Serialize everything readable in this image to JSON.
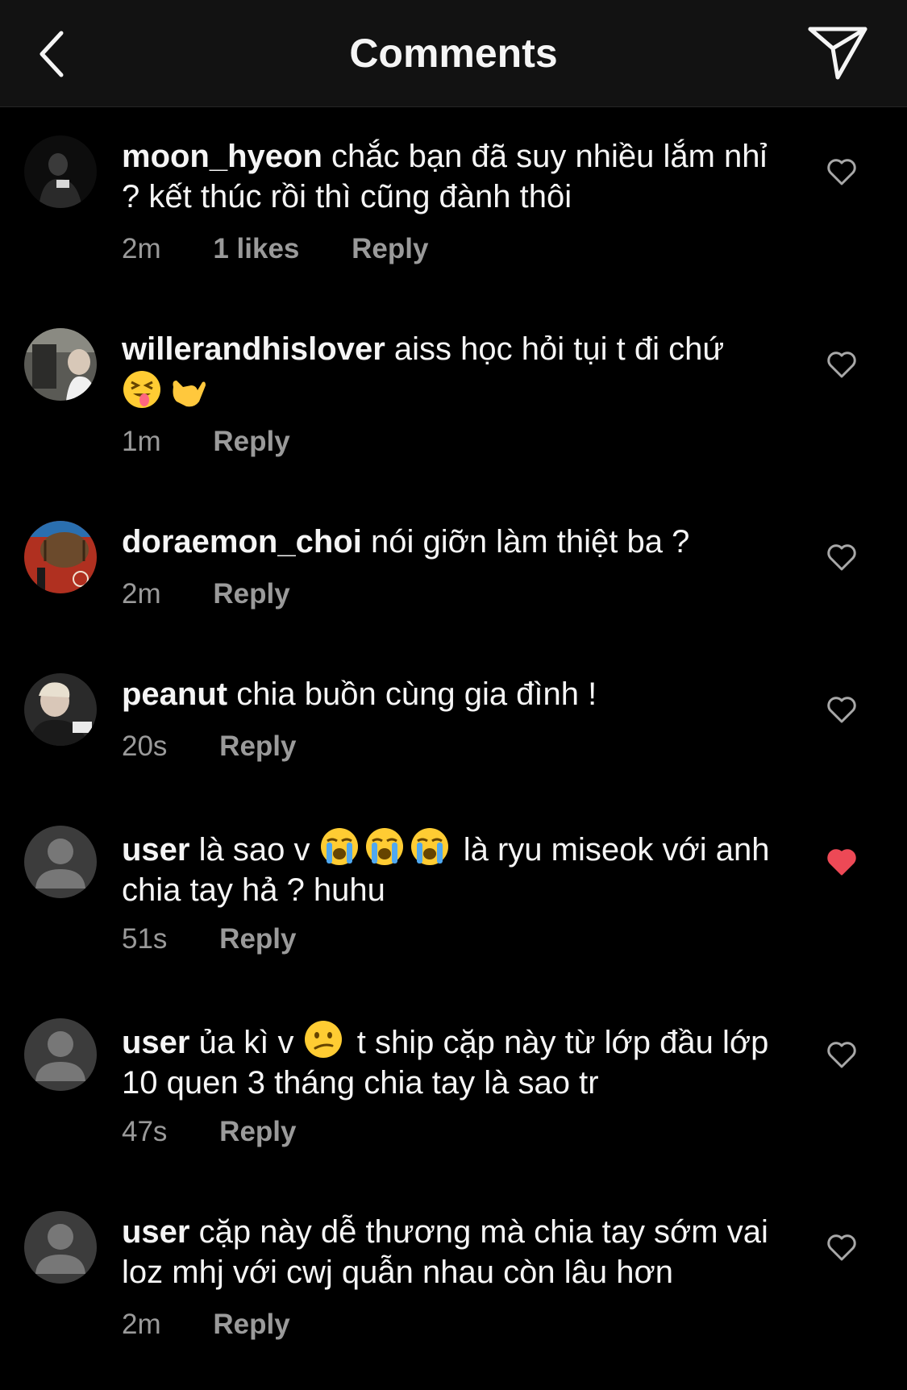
{
  "header": {
    "title": "Comments",
    "back_icon": "chevron-left-icon",
    "send_icon": "paper-plane-icon"
  },
  "colors": {
    "background": "#000000",
    "header_background": "#121212",
    "meta_text": "#9a9a9a",
    "liked_heart": "#ed4956"
  },
  "comments": [
    {
      "username": "moon_hyeon",
      "text": "chắc bạn đã suy nhiều lắm nhỉ ? kết thúc rồi thì cũng đành thôi",
      "time": "2m",
      "likes": "1 likes",
      "reply": "Reply",
      "liked": false
    },
    {
      "username": "willerandhislover",
      "text": "aiss học hỏi tụi t đi chứ",
      "emojis": [
        "squinting-tongue-emoji",
        "call-me-hand-emoji"
      ],
      "time": "1m",
      "reply": "Reply",
      "liked": false
    },
    {
      "username": "doraemon_choi",
      "text": " nói giỡn làm thiệt ba ?",
      "time": "2m",
      "reply": "Reply",
      "liked": false
    },
    {
      "username": "peanut",
      "text": "chia buồn cùng gia đình !",
      "time": "20s",
      "reply": "Reply",
      "liked": false
    },
    {
      "username": "user",
      "text_before": "là sao v",
      "emojis": [
        "loudly-crying-emoji",
        "loudly-crying-emoji",
        "loudly-crying-emoji"
      ],
      "text_after": "là ryu miseok với anh chia tay hả ? huhu",
      "time": "51s",
      "reply": "Reply",
      "liked": true
    },
    {
      "username": "user",
      "text_before": "ủa kì v",
      "emojis": [
        "confused-face-emoji"
      ],
      "text_after": "t ship cặp này từ lớp đầu lớp 10 quen 3 tháng chia tay là sao tr",
      "time": "47s",
      "reply": "Reply",
      "liked": false
    },
    {
      "username": "user",
      "text": "cặp này dễ thương mà chia tay sớm vai loz mhj với cwj quẫn nhau còn lâu hơn",
      "time": "2m",
      "reply": "Reply",
      "liked": false
    }
  ]
}
